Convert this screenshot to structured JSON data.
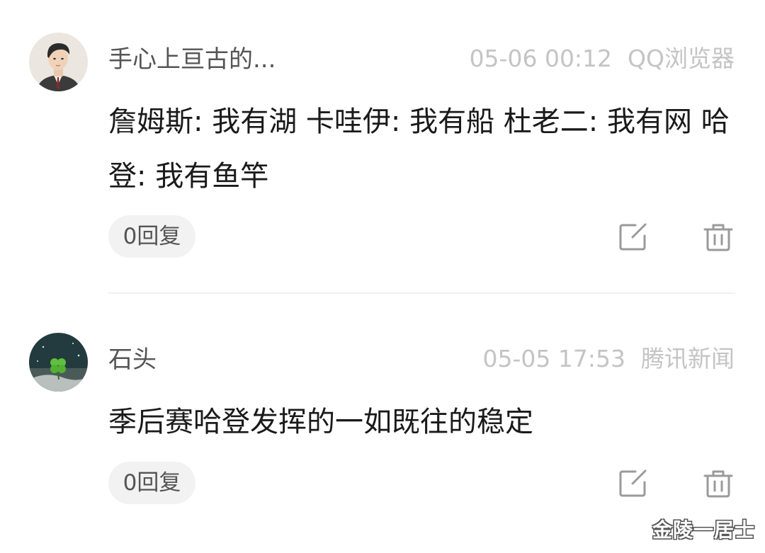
{
  "comments": [
    {
      "username": "手心上亘古的...",
      "timestamp": "05-06 00:12",
      "source": "QQ浏览器",
      "text": "詹姆斯: 我有湖 卡哇伊: 我有船 杜老二: 我有网 哈 登: 我有鱼竿",
      "reply_label": "0回复",
      "avatar": "man-portrait-avatar"
    },
    {
      "username": "石头",
      "timestamp": "05-05 17:53",
      "source": "腾讯新闻",
      "text": "季后赛哈登发挥的一如既往的稳定",
      "reply_label": "0回复",
      "avatar": "clover-avatar"
    }
  ],
  "icons": {
    "edit": "edit-icon",
    "delete": "trash-icon"
  },
  "watermark": "金陵一居士",
  "colors": {
    "username": "#555555",
    "meta": "#c4c4c4",
    "body": "#1a1a1a",
    "reply_bg": "#f2f2f2",
    "divider": "#f1f1f1",
    "icon": "#9a9a9a"
  }
}
